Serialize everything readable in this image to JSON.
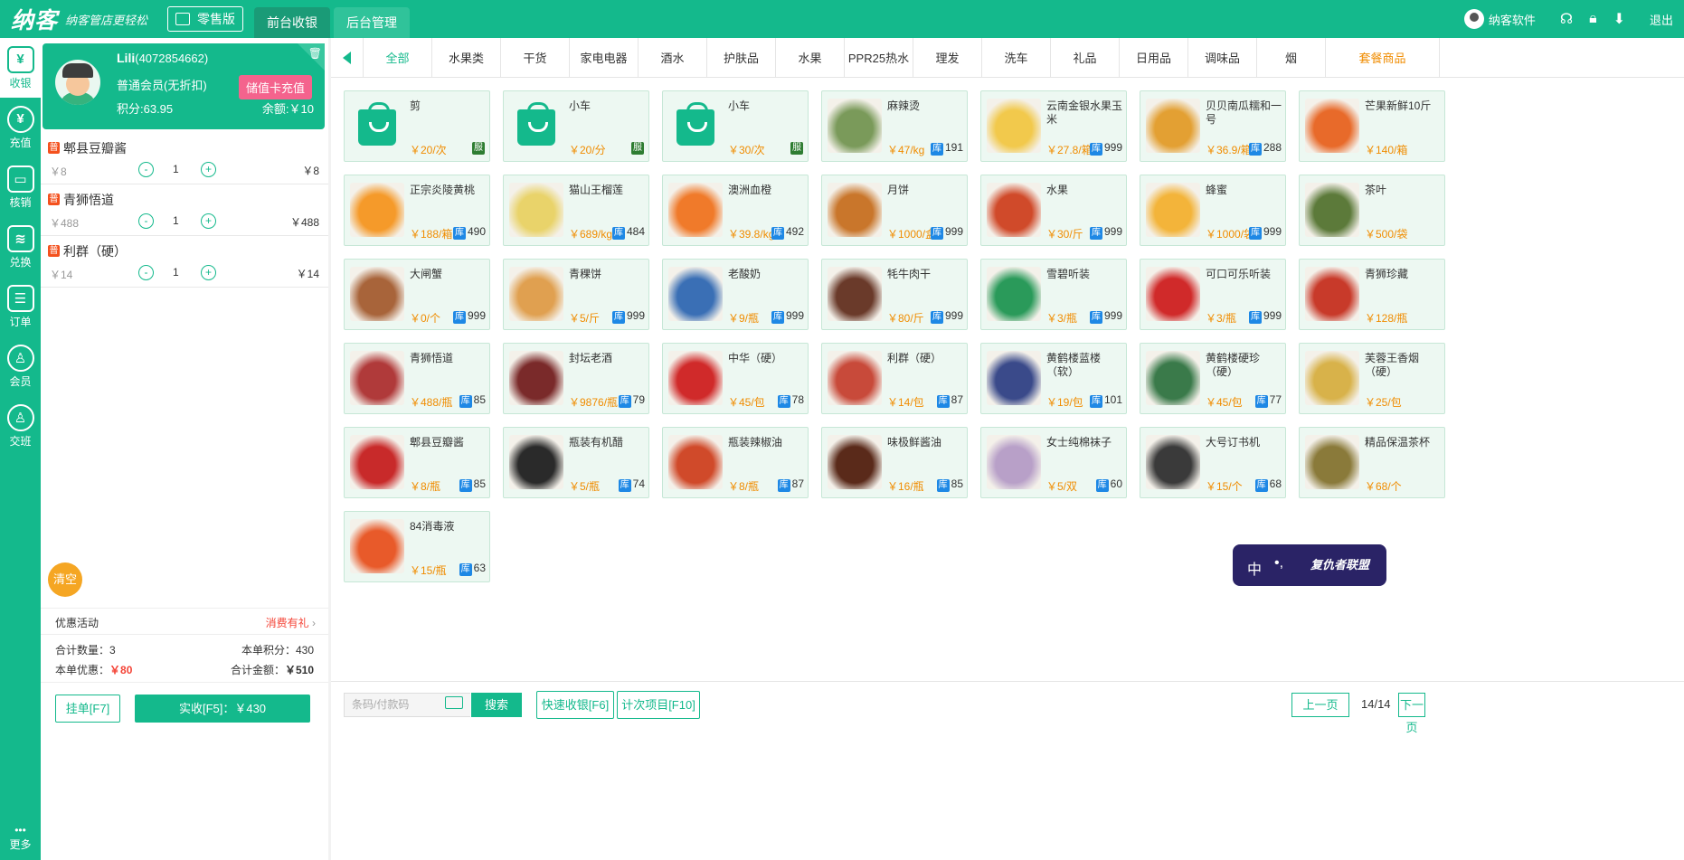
{
  "brand": {
    "logo": "纳客",
    "slogan": "纳客管店更轻松"
  },
  "edition": "零售版",
  "top_tabs": [
    "前台收银",
    "后台管理"
  ],
  "topbar": {
    "user": "纳客软件",
    "logout": "退出"
  },
  "sidebar": {
    "items": [
      {
        "label": "收银",
        "icon": "cash-register-icon",
        "glyph": "¥"
      },
      {
        "label": "充值",
        "icon": "recharge-icon",
        "glyph": "¥"
      },
      {
        "label": "核销",
        "icon": "ticket-icon",
        "glyph": "▭"
      },
      {
        "label": "兑换",
        "icon": "exchange-icon",
        "glyph": "≋"
      },
      {
        "label": "订单",
        "icon": "order-icon",
        "glyph": "☰"
      },
      {
        "label": "会员",
        "icon": "member-icon",
        "glyph": "♙"
      },
      {
        "label": "交班",
        "icon": "handover-icon",
        "glyph": "♙"
      }
    ],
    "more": "更多"
  },
  "member": {
    "name": "Lili",
    "id": "(4072854662)",
    "level": "普通会员(无折扣)",
    "recharge_label": "储值卡充值",
    "points": "积分:63.95",
    "balance": "余额:￥10"
  },
  "cart": {
    "items": [
      {
        "name": "郫县豆瓣酱",
        "price": "￥8",
        "qty": "1",
        "subtotal": "￥8"
      },
      {
        "name": "青狮悟道",
        "price": "￥488",
        "qty": "1",
        "subtotal": "￥488"
      },
      {
        "name": "利群（硬）",
        "price": "￥14",
        "qty": "1",
        "subtotal": "￥14"
      }
    ],
    "badge": "普",
    "minus": "-",
    "plus": "+",
    "clear_label": "清空",
    "promo_label": "优惠活动",
    "promo_value": "消费有礼",
    "total_qty_label": "合计数量：",
    "total_qty": "3",
    "points_label": "本单积分：",
    "points": "430",
    "discount_label": "本单优惠：",
    "discount": "￥80",
    "total_label": "合计金额：",
    "total": "￥510",
    "hold_label": "挂单[F7]",
    "pay_label": "实收[F5]：￥430"
  },
  "categories": [
    "全部",
    "水果类",
    "干货",
    "家电电器",
    "酒水",
    "护肤品",
    "水果",
    "PPR25热水",
    "理发",
    "洗车",
    "礼品",
    "日用品",
    "调味品",
    "烟",
    "套餐商品"
  ],
  "products": [
    {
      "name": "剪",
      "price": "￥20/次",
      "flag": "服",
      "img": "bag"
    },
    {
      "name": "小车",
      "price": "￥20/分",
      "flag": "服",
      "img": "bag"
    },
    {
      "name": "小车",
      "price": "￥30/次",
      "flag": "服",
      "img": "bag"
    },
    {
      "name": "麻辣烫",
      "price": "￥47/kg",
      "stock": "191",
      "color": "#7a9a5a"
    },
    {
      "name": "云南金银水果玉米",
      "price": "￥27.8/箱",
      "stock": "999",
      "color": "#f2c94c"
    },
    {
      "name": "贝贝南瓜糯和一号",
      "price": "￥36.9/箱",
      "stock": "288",
      "color": "#e3a033"
    },
    {
      "name": "芒果新鲜10斤",
      "price": "￥140/箱",
      "stock": "",
      "color": "#e86a2a"
    },
    {
      "name": "正宗炎陵黄桃",
      "price": "￥188/箱",
      "stock": "490",
      "color": "#f59a2a"
    },
    {
      "name": "猫山王榴莲",
      "price": "￥689/kg",
      "stock": "484",
      "color": "#e9d36a"
    },
    {
      "name": "澳洲血橙",
      "price": "￥39.8/kg",
      "stock": "492",
      "color": "#f07a2a"
    },
    {
      "name": "月饼",
      "price": "￥1000/盒",
      "stock": "999",
      "color": "#c9762b"
    },
    {
      "name": "水果",
      "price": "￥30/斤",
      "stock": "999",
      "color": "#d04a2a"
    },
    {
      "name": "蜂蜜",
      "price": "￥1000/袋",
      "stock": "999",
      "color": "#f3b43a"
    },
    {
      "name": "茶叶",
      "price": "￥500/袋",
      "stock": "",
      "color": "#5c7a3a"
    },
    {
      "name": "大闸蟹",
      "price": "￥0/个",
      "stock": "999",
      "color": "#a8643a"
    },
    {
      "name": "青稞饼",
      "price": "￥5/斤",
      "stock": "999",
      "color": "#e0a050"
    },
    {
      "name": "老酸奶",
      "price": "￥9/瓶",
      "stock": "999",
      "color": "#3a6fb5"
    },
    {
      "name": "牦牛肉干",
      "price": "￥80/斤",
      "stock": "999",
      "color": "#6a3a2a"
    },
    {
      "name": "雪碧听装",
      "price": "￥3/瓶",
      "stock": "999",
      "color": "#2a9a5a"
    },
    {
      "name": "可口可乐听装",
      "price": "￥3/瓶",
      "stock": "999",
      "color": "#d02a2a"
    },
    {
      "name": "青狮珍藏",
      "price": "￥128/瓶",
      "stock": "",
      "color": "#c83a2a"
    },
    {
      "name": "青狮悟道",
      "price": "￥488/瓶",
      "stock": "85",
      "color": "#b03a3a"
    },
    {
      "name": "封坛老酒",
      "price": "￥9876/瓶",
      "stock": "79",
      "color": "#7a2a2a"
    },
    {
      "name": "中华（硬）",
      "price": "￥45/包",
      "stock": "78",
      "color": "#d02a2a"
    },
    {
      "name": "利群（硬）",
      "price": "￥14/包",
      "stock": "87",
      "color": "#c84a3a"
    },
    {
      "name": "黄鹤楼蓝楼（软）",
      "price": "￥19/包",
      "stock": "101",
      "color": "#3a4a8a"
    },
    {
      "name": "黄鹤楼硬珍（硬）",
      "price": "￥45/包",
      "stock": "77",
      "color": "#3a7a4a"
    },
    {
      "name": "芙蓉王香烟（硬）",
      "price": "￥25/包",
      "stock": "",
      "color": "#d8b24a"
    },
    {
      "name": "郫县豆瓣酱",
      "price": "￥8/瓶",
      "stock": "85",
      "color": "#c82a2a"
    },
    {
      "name": "瓶装有机醋",
      "price": "￥5/瓶",
      "stock": "74",
      "color": "#2a2a2a"
    },
    {
      "name": "瓶装辣椒油",
      "price": "￥8/瓶",
      "stock": "87",
      "color": "#d04a2a"
    },
    {
      "name": "味极鲜酱油",
      "price": "￥16/瓶",
      "stock": "85",
      "color": "#5a2a1a"
    },
    {
      "name": "女士纯棉袜子",
      "price": "￥5/双",
      "stock": "60",
      "color": "#b8a0c8"
    },
    {
      "name": "大号订书机",
      "price": "￥15/个",
      "stock": "68",
      "color": "#3a3a3a"
    },
    {
      "name": "精品保温茶杯",
      "price": "￥68/个",
      "stock": "",
      "color": "#8a7a3a"
    },
    {
      "name": "84消毒液",
      "price": "￥15/瓶",
      "stock": "63",
      "color": "#e85a2a"
    }
  ],
  "stock_badge": "库",
  "bottom": {
    "barcode_placeholder": "条码/付款码",
    "search_label": "搜索",
    "quick_label": "快速收银[F6]",
    "count_label": "计次项目[F10]",
    "prev_label": "上一页",
    "page_info": "14/14",
    "next_label": "下一页"
  },
  "ime": {
    "lang": "中",
    "dot": "•,",
    "hero": "复仇者联盟"
  }
}
